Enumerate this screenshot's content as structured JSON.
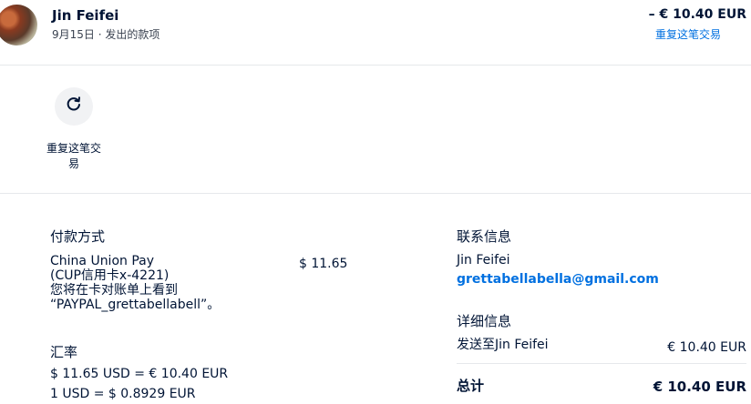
{
  "header": {
    "name": "Jin Feifei",
    "subtitle": "9月15日 · 发出的款项",
    "amount": "– € 10.40 EUR",
    "repeat_link": "重复这笔交易"
  },
  "actions": {
    "repeat_label": "重复这笔交\n易",
    "repeat_icon": "refresh-icon"
  },
  "payment": {
    "heading": "付款方式",
    "method_lines": [
      "China Union Pay",
      "(CUP信用卡x-4221)",
      "您将在卡对账单上看到",
      "“PAYPAL_grettabellabell”。"
    ],
    "amount": "$ 11.65"
  },
  "exchange": {
    "heading": "汇率",
    "line1": "$ 11.65 USD = € 10.40 EUR",
    "line2": "1 USD = $ 0.8929 EUR"
  },
  "contact": {
    "heading": "联系信息",
    "name": "Jin Feifei",
    "email": "grettabellabella@gmail.com"
  },
  "details": {
    "heading": "详细信息",
    "sent_to_label": "发送至Jin Feifei",
    "sent_to_amount": "€ 10.40 EUR",
    "total_label": "总计",
    "total_amount": "€ 10.40 EUR"
  }
}
